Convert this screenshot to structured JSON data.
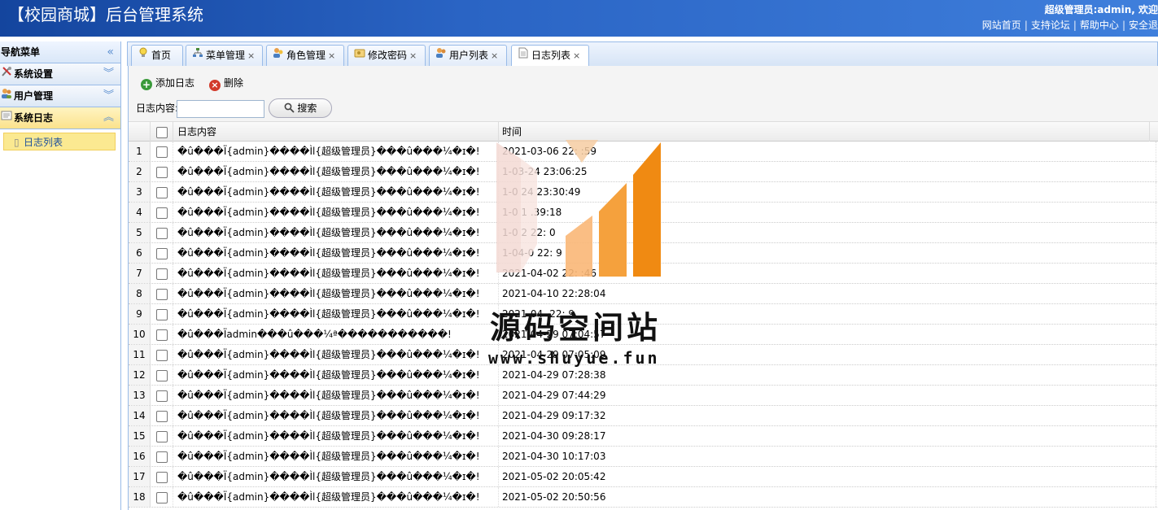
{
  "header": {
    "title": "【校园商城】后台管理系统",
    "welcome": "超级管理员:admin, 欢迎",
    "links": [
      "网站首页",
      "支持论坛",
      "帮助中心",
      "安全退"
    ]
  },
  "nav": {
    "title": "导航菜单",
    "collapse_glyph": "«",
    "groups": [
      {
        "label": "系统设置",
        "icon": "tools-icon",
        "state": "collapsed"
      },
      {
        "label": "用户管理",
        "icon": "users-icon",
        "state": "collapsed"
      },
      {
        "label": "系统日志",
        "icon": "log-icon",
        "state": "expanded"
      }
    ],
    "sub_items": [
      {
        "label": "日志列表",
        "icon": "page-icon"
      }
    ]
  },
  "tabs": [
    {
      "label": "首页",
      "icon": "bulb-icon",
      "closable": false
    },
    {
      "label": "菜单管理",
      "icon": "sitemap-icon",
      "closable": true
    },
    {
      "label": "角色管理",
      "icon": "roles-icon",
      "closable": true
    },
    {
      "label": "修改密码",
      "icon": "key-icon",
      "closable": true
    },
    {
      "label": "用户列表",
      "icon": "users-icon",
      "closable": true
    },
    {
      "label": "日志列表",
      "icon": "page-icon",
      "closable": true,
      "active": true
    }
  ],
  "toolbar": {
    "add_label": "添加日志",
    "delete_label": "删除",
    "search_label": "日志内容:",
    "search_value": "",
    "search_button": "搜索"
  },
  "grid": {
    "columns": [
      "日志内容",
      "时间"
    ],
    "rows": [
      {
        "num": "1",
        "content": "�û���Ï{admin}����Ìl{超级管理员}���û���¼�ɪ�!",
        "time": "2021-03-06 22:  :59"
      },
      {
        "num": "2",
        "content": "�û���Ï{admin}����Ìl{超级管理员}���û���¼�ɪ�!",
        "time": "  1-03-24 23:06:25"
      },
      {
        "num": "3",
        "content": "�û���Ï{admin}����Ìl{超级管理员}���û���¼�ɪ�!",
        "time": "  1-0  24 23:30:49"
      },
      {
        "num": "4",
        "content": "�û���Ï{admin}����Ìl{超级管理员}���û���¼�ɪ�!",
        "time": "  1-0     1 .39:18"
      },
      {
        "num": "5",
        "content": "�û���Ï{admin}����Ìl{超级管理员}���û���¼�ɪ�!",
        "time": "  1-0   2 22:  0"
      },
      {
        "num": "6",
        "content": "�û���Ï{admin}����Ìl{超级管理员}���û���¼�ɪ�!",
        "time": "  1-04-0  22:  9"
      },
      {
        "num": "7",
        "content": "�û���Ï{admin}����Ìl{超级管理员}���û���¼�ɪ�!",
        "time": "2021-04-02 22:  :46"
      },
      {
        "num": "8",
        "content": "�û���Ï{admin}����Ìl{超级管理员}���û���¼�ɪ�!",
        "time": "2021-04-10 22:28:04"
      },
      {
        "num": "9",
        "content": "�û���Ï{admin}����Ìl{超级管理员}���û���¼�ɪ�!",
        "time": "2021-04-   22:  9"
      },
      {
        "num": "10",
        "content": "�û���Ïadmin���û���¼ª�����������!",
        "time": "2021-04-29 07:04:57"
      },
      {
        "num": "11",
        "content": "�û���Ï{admin}����Ìl{超级管理员}���û���¼�ɪ�!",
        "time": "2021-04-29 07:05:09"
      },
      {
        "num": "12",
        "content": "�û���Ï{admin}����Ìl{超级管理员}���û���¼�ɪ�!",
        "time": "2021-04-29 07:28:38"
      },
      {
        "num": "13",
        "content": "�û���Ï{admin}����Ìl{超级管理员}���û���¼�ɪ�!",
        "time": "2021-04-29 07:44:29"
      },
      {
        "num": "14",
        "content": "�û���Ï{admin}����Ìl{超级管理员}���û���¼�ɪ�!",
        "time": "2021-04-29 09:17:32"
      },
      {
        "num": "15",
        "content": "�û���Ï{admin}����Ìl{超级管理员}���û���¼�ɪ�!",
        "time": "2021-04-30 09:28:17"
      },
      {
        "num": "16",
        "content": "�û���Ï{admin}����Ìl{超级管理员}���û���¼�ɪ�!",
        "time": "2021-04-30 10:17:03"
      },
      {
        "num": "17",
        "content": "�û���Ï{admin}����Ìl{超级管理员}���û���¼�ɪ�!",
        "time": "2021-05-02 20:05:42"
      },
      {
        "num": "18",
        "content": "�û���Ï{admin}����Ìl{超级管理员}���û���¼�ɪ�!",
        "time": "2021-05-02 20:50:56"
      }
    ]
  },
  "watermark": {
    "text": "源码空间站",
    "url": "www.shuyue.fun"
  },
  "colors": {
    "header": "#2a64c4",
    "accent_border": "#99bbe8",
    "active_nav": "#fbe991",
    "watermark_orange": "#f39a2e"
  }
}
